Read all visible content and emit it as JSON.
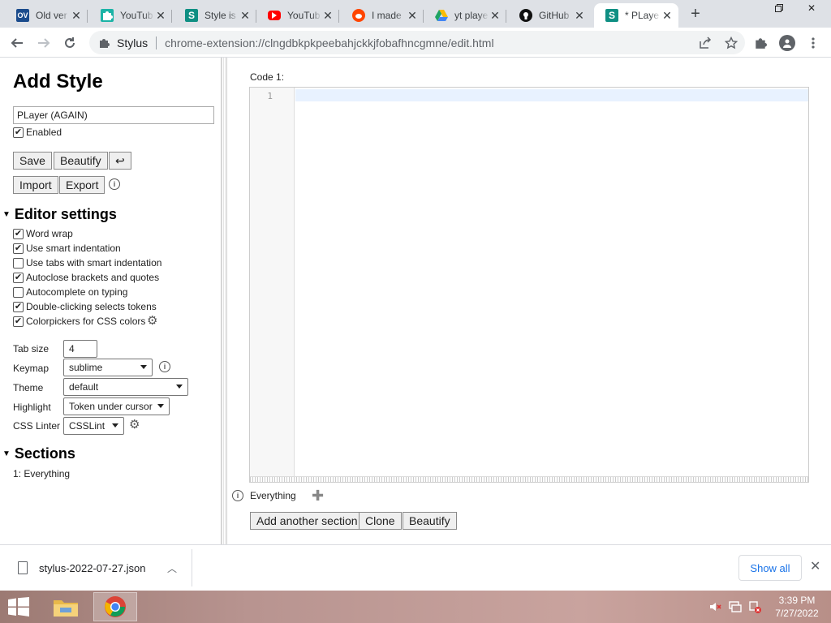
{
  "tabs": [
    {
      "title": "Old ver",
      "favicon": "ov-favicon",
      "favicon_text": "OV",
      "color": "#1a4b8c"
    },
    {
      "title": "YouTub",
      "favicon": "puzzle-favicon",
      "favicon_text": "",
      "color": "#1bb3a6"
    },
    {
      "title": "Style is",
      "favicon": "stylus-favicon",
      "favicon_text": "S",
      "color": "#0f8f83"
    },
    {
      "title": "YouTub",
      "favicon": "youtube-favicon",
      "favicon_text": "",
      "color": "#ff0000"
    },
    {
      "title": "I made",
      "favicon": "reddit-favicon",
      "favicon_text": "",
      "color": "#ff4500"
    },
    {
      "title": "yt playe",
      "favicon": "drive-favicon",
      "favicon_text": "",
      "color": "#1fa463"
    },
    {
      "title": "GitHub",
      "favicon": "github-favicon",
      "favicon_text": "",
      "color": "#111111"
    },
    {
      "title": "* PLaye",
      "favicon": "stylus-favicon",
      "favicon_text": "S",
      "color": "#0f8f83",
      "active": true
    }
  ],
  "toolbar": {
    "site_name": "Stylus",
    "url": "chrome-extension://clngdbkpkpeebahjckkjfobafhncgmne/edit.html"
  },
  "sidebar": {
    "title": "Add Style",
    "style_name": "PLayer (AGAIN)",
    "enabled_label": "Enabled",
    "enabled": true,
    "buttons": {
      "save": "Save",
      "beautify": "Beautify",
      "undo": "↩",
      "import": "Import",
      "export": "Export"
    },
    "editor_settings": {
      "heading": "Editor settings",
      "options": [
        {
          "label": "Word wrap",
          "checked": true
        },
        {
          "label": "Use smart indentation",
          "checked": true
        },
        {
          "label": "Use tabs with smart indentation",
          "checked": false
        },
        {
          "label": "Autoclose brackets and quotes",
          "checked": true
        },
        {
          "label": "Autocomplete on typing",
          "checked": false
        },
        {
          "label": "Double-clicking selects tokens",
          "checked": true
        },
        {
          "label": "Colorpickers for CSS colors",
          "checked": true
        }
      ],
      "tab_size_label": "Tab size",
      "tab_size": "4",
      "keymap_label": "Keymap",
      "keymap": "sublime",
      "theme_label": "Theme",
      "theme": "default",
      "highlight_label": "Highlight",
      "highlight": "Token under cursor",
      "linter_label": "CSS Linter",
      "linter": "CSSLint"
    },
    "sections": {
      "heading": "Sections",
      "items": [
        "1: Everything"
      ]
    }
  },
  "editor": {
    "code_label": "Code 1:",
    "line_numbers": [
      "1"
    ],
    "applies_to": "Everything",
    "buttons": {
      "add_section": "Add another section",
      "clone": "Clone",
      "beautify": "Beautify"
    }
  },
  "download_bar": {
    "file_name": "stylus-2022-07-27.json",
    "show_all": "Show all"
  },
  "taskbar": {
    "time": "3:39 PM",
    "date": "7/27/2022"
  }
}
